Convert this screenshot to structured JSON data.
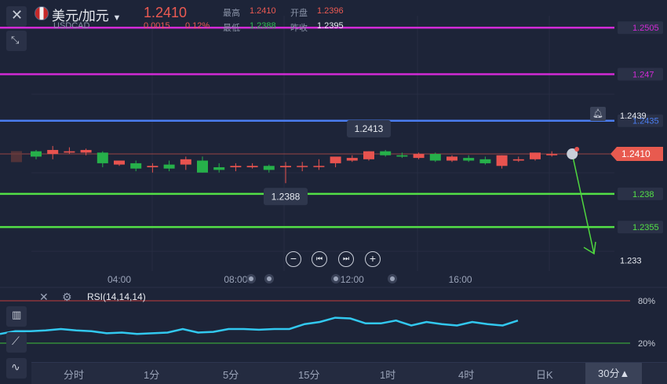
{
  "header": {
    "pair_name": "美元/加元",
    "symbol": "USDCAD",
    "last_price": "1.2410",
    "change": "0.0015",
    "change_pct": "0.12%",
    "high_label": "最高",
    "high_value": "1.2410",
    "open_label": "开盘",
    "open_value": "1.2396",
    "low_label": "最低",
    "low_value": "1.2388",
    "prev_close_label": "昨收",
    "prev_close_value": "1.2395"
  },
  "chart_data": {
    "type": "candlestick",
    "ylim": [
      1.2322,
      1.2514
    ],
    "x_ticks": [
      "04:00",
      "08:00",
      "12:00",
      "16:00"
    ],
    "x_tick_index": [
      5,
      12,
      19,
      25.5
    ],
    "candles": [
      {
        "o": 1.2412,
        "h": 1.2413,
        "c": 1.2408,
        "l": 1.2406
      },
      {
        "o": 1.241,
        "h": 1.2416,
        "c": 1.2413,
        "l": 1.2406
      },
      {
        "o": 1.2411,
        "h": 1.2415,
        "c": 1.2412,
        "l": 1.241
      },
      {
        "o": 1.2411,
        "h": 1.2414,
        "c": 1.2413,
        "l": 1.2409
      },
      {
        "o": 1.2411,
        "h": 1.2412,
        "c": 1.2403,
        "l": 1.24
      },
      {
        "o": 1.2402,
        "h": 1.2405,
        "c": 1.2405,
        "l": 1.2401
      },
      {
        "o": 1.2403,
        "h": 1.2405,
        "c": 1.2399,
        "l": 1.2397
      },
      {
        "o": 1.24,
        "h": 1.2403,
        "c": 1.2401,
        "l": 1.2396
      },
      {
        "o": 1.2402,
        "h": 1.2405,
        "c": 1.2399,
        "l": 1.2397
      },
      {
        "o": 1.2402,
        "h": 1.2408,
        "c": 1.2406,
        "l": 1.2398
      },
      {
        "o": 1.2405,
        "h": 1.2408,
        "c": 1.2396,
        "l": 1.2396
      },
      {
        "o": 1.24,
        "h": 1.2403,
        "c": 1.2398,
        "l": 1.2396
      },
      {
        "o": 1.24,
        "h": 1.2403,
        "c": 1.2401,
        "l": 1.2397
      },
      {
        "o": 1.24,
        "h": 1.2403,
        "c": 1.2401,
        "l": 1.2399
      },
      {
        "o": 1.2401,
        "h": 1.2402,
        "c": 1.2398,
        "l": 1.2396
      },
      {
        "o": 1.24,
        "h": 1.2404,
        "c": 1.2401,
        "l": 1.2388
      },
      {
        "o": 1.2401,
        "h": 1.2404,
        "c": 1.2401,
        "l": 1.2397
      },
      {
        "o": 1.2401,
        "h": 1.2406,
        "c": 1.2401,
        "l": 1.2398
      },
      {
        "o": 1.2403,
        "h": 1.2407,
        "c": 1.2408,
        "l": 1.24
      },
      {
        "o": 1.2405,
        "h": 1.2409,
        "c": 1.2407,
        "l": 1.2404
      },
      {
        "o": 1.2406,
        "h": 1.2412,
        "c": 1.2412,
        "l": 1.2405
      },
      {
        "o": 1.2412,
        "h": 1.2413,
        "c": 1.2409,
        "l": 1.2408
      },
      {
        "o": 1.2409,
        "h": 1.2411,
        "c": 1.2408,
        "l": 1.2407
      },
      {
        "o": 1.2407,
        "h": 1.2411,
        "c": 1.241,
        "l": 1.2406
      },
      {
        "o": 1.241,
        "h": 1.2411,
        "c": 1.2405,
        "l": 1.2404
      },
      {
        "o": 1.2405,
        "h": 1.2409,
        "c": 1.2408,
        "l": 1.2404
      },
      {
        "o": 1.2407,
        "h": 1.2409,
        "c": 1.2405,
        "l": 1.2404
      },
      {
        "o": 1.2406,
        "h": 1.2408,
        "c": 1.2403,
        "l": 1.2402
      },
      {
        "o": 1.2401,
        "h": 1.2409,
        "c": 1.2409,
        "l": 1.2399
      },
      {
        "o": 1.2405,
        "h": 1.2408,
        "c": 1.2406,
        "l": 1.2404
      },
      {
        "o": 1.2406,
        "h": 1.2411,
        "c": 1.2411,
        "l": 1.2405
      },
      {
        "o": 1.2409,
        "h": 1.2412,
        "c": 1.241,
        "l": 1.2408
      }
    ],
    "candle_colors": {
      "up": "#e8534f",
      "down": "#26b04a"
    },
    "annotations": {
      "max_label": "1.2413",
      "max_index": 20,
      "max_value": 1.2413,
      "min_label": "1.2388",
      "min_index": 15,
      "min_value": 1.2388
    },
    "horizontal_lines": [
      {
        "value": 1.2505,
        "label": "1.2505",
        "color": "#d22ad6"
      },
      {
        "value": 1.247,
        "label": "1.247",
        "color": "#d22ad6"
      },
      {
        "value": 1.2435,
        "label": "1.2435",
        "color": "#4a7df0"
      },
      {
        "value": 1.238,
        "label": "1.238",
        "color": "#53e046"
      },
      {
        "value": 1.2355,
        "label": "1.2355",
        "color": "#53e046"
      }
    ],
    "extra_price_labels": [
      {
        "value": 1.2439,
        "label": "1.2439"
      },
      {
        "value": 1.233,
        "label": "1.233"
      }
    ],
    "current_price": {
      "value": 1.241,
      "label": "1.2410",
      "color": "#e85a4f"
    },
    "trend_arrow": {
      "from_value": 1.241,
      "to_value": 1.2335,
      "color": "#4fd63f"
    },
    "rsi": {
      "label": "RSI(14,14,14)",
      "levels": [
        80,
        20
      ],
      "level_labels": [
        "80%",
        "20%"
      ],
      "color": "#32c8ef",
      "values": [
        33,
        37,
        37,
        38,
        40,
        38,
        37,
        34,
        35,
        33,
        34,
        35,
        40,
        35,
        36,
        40,
        40,
        39,
        40,
        40,
        47,
        50,
        56,
        55,
        48,
        48,
        52,
        45,
        50,
        47,
        45,
        50,
        47,
        45,
        52
      ]
    }
  },
  "controls": {
    "zoom_out": "−",
    "prev": "⏮",
    "next": "⏭",
    "zoom_in": "+"
  },
  "timeframes": {
    "items": [
      "分时",
      "1分",
      "5分",
      "15分",
      "1时",
      "4时",
      "日K",
      "30分▲"
    ],
    "active": "30分▲"
  },
  "colors": {
    "background": "#1d2438",
    "grid": "#2a3147",
    "price_up": "#e8534f",
    "price_down": "#26b04a"
  }
}
